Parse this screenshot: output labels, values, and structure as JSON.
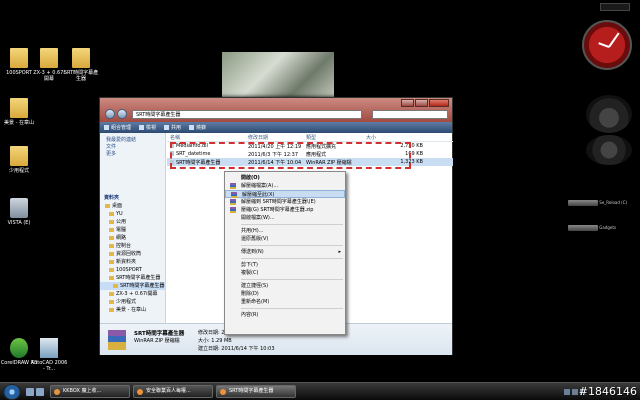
{
  "desktop": {
    "icons": [
      {
        "label": "100SPORT",
        "kind": "folder"
      },
      {
        "label": "ZX-3 + 0.67i 開幕",
        "kind": "folder"
      },
      {
        "label": "SRT時間字幕產生器",
        "kind": "folder"
      },
      {
        "label": "美景 - 在章山",
        "kind": "folder"
      },
      {
        "label": "少用程式",
        "kind": "folder"
      },
      {
        "label": "VISTA (E)",
        "kind": "drive"
      },
      {
        "label": "CorelDRAW X3",
        "kind": "app"
      },
      {
        "label": "AutoCAD 2006 - Tr...",
        "kind": "app"
      }
    ]
  },
  "gadgets": {
    "drive1": "Se_Reload (C)",
    "drive2": "Gadgets"
  },
  "window": {
    "address": "SRT時間字幕產生器",
    "toolbar": [
      "組合管理",
      "檢視",
      "共用",
      "燒錄"
    ],
    "favorites": [
      "我最愛的連結",
      "文件",
      "更多"
    ],
    "tree_header": "資料夾",
    "tree": [
      {
        "label": "桌面",
        "selected": false
      },
      {
        "label": "YU",
        "selected": false
      },
      {
        "label": "公用",
        "selected": false
      },
      {
        "label": "電腦",
        "selected": false
      },
      {
        "label": "網路",
        "selected": false
      },
      {
        "label": "控制台",
        "selected": false
      },
      {
        "label": "資源回收筒",
        "selected": false
      },
      {
        "label": "新資料夾",
        "selected": false
      },
      {
        "label": "100SPORT",
        "selected": false
      },
      {
        "label": "SRT時間字幕產生器",
        "selected": false
      },
      {
        "label": "SRT時間字幕產生器",
        "selected": true
      },
      {
        "label": "ZX-3 + 0.67i開幕",
        "selected": false
      },
      {
        "label": "少用程式",
        "selected": false
      },
      {
        "label": "美景 - 在章山",
        "selected": false
      }
    ],
    "columns": [
      "名稱",
      "修改日期",
      "類型",
      "大小"
    ],
    "rows": [
      {
        "name": "MediaInfo.dll",
        "date": "2011/4/20 上午 12:19",
        "type": "應用程式擴充",
        "size": "2,720 KB",
        "selected": false
      },
      {
        "name": "SRT_datetime",
        "date": "2011/6/3 下午 12:37",
        "type": "應用程式",
        "size": "169 KB",
        "selected": false
      },
      {
        "name": "SRT時間字幕產生器",
        "date": "2011/6/14 下午 10:04",
        "type": "WinRAR ZIP 壓縮檔",
        "size": "1,323 KB",
        "selected": true
      }
    ],
    "details": {
      "name": "SRT時間字幕產生器",
      "type": "WinRAR ZIP 壓縮檔",
      "modified_label": "修改日期: 2011/6/14 下午 10:04",
      "size_label": "大小: 1.29 MB",
      "created_label": "建立日期: 2011/6/14 下午 10:03"
    }
  },
  "context_menu": {
    "items": [
      {
        "label": "開啟(O)",
        "bold": true,
        "icon": false,
        "arrow": false,
        "sep_after": false,
        "highlight": false
      },
      {
        "label": "解壓縮檔案(A)...",
        "bold": false,
        "icon": true,
        "arrow": false,
        "sep_after": false,
        "highlight": false
      },
      {
        "label": "解壓縮至此(X)",
        "bold": false,
        "icon": true,
        "arrow": false,
        "sep_after": false,
        "highlight": true
      },
      {
        "label": "解壓縮到 SRT時間字幕產生器\\(E)",
        "bold": false,
        "icon": true,
        "arrow": false,
        "sep_after": false,
        "highlight": false
      },
      {
        "label": "壓縮(G) SRT時間字幕產生器.zip",
        "bold": false,
        "icon": true,
        "arrow": false,
        "sep_after": false,
        "highlight": false
      },
      {
        "label": "開啟檔案(W)...",
        "bold": false,
        "icon": false,
        "arrow": false,
        "sep_after": true,
        "highlight": false
      },
      {
        "label": "共用(H)...",
        "bold": false,
        "icon": false,
        "arrow": false,
        "sep_after": false,
        "highlight": false
      },
      {
        "label": "還原舊版(V)",
        "bold": false,
        "icon": false,
        "arrow": false,
        "sep_after": true,
        "highlight": false
      },
      {
        "label": "傳送到(N)",
        "bold": false,
        "icon": false,
        "arrow": true,
        "sep_after": true,
        "highlight": false
      },
      {
        "label": "剪下(T)",
        "bold": false,
        "icon": false,
        "arrow": false,
        "sep_after": false,
        "highlight": false
      },
      {
        "label": "複製(C)",
        "bold": false,
        "icon": false,
        "arrow": false,
        "sep_after": true,
        "highlight": false
      },
      {
        "label": "建立捷徑(S)",
        "bold": false,
        "icon": false,
        "arrow": false,
        "sep_after": false,
        "highlight": false
      },
      {
        "label": "刪除(D)",
        "bold": false,
        "icon": false,
        "arrow": false,
        "sep_after": false,
        "highlight": false
      },
      {
        "label": "重新命名(M)",
        "bold": false,
        "icon": false,
        "arrow": false,
        "sep_after": true,
        "highlight": false
      },
      {
        "label": "內容(R)",
        "bold": false,
        "icon": false,
        "arrow": false,
        "sep_after": false,
        "highlight": false
      }
    ]
  },
  "taskbar": {
    "tasks": [
      {
        "label": "KKBOX 魔上收...",
        "active": false
      },
      {
        "label": "安全聯業百人每權...",
        "active": false
      },
      {
        "label": "SRT時間字幕產生器",
        "active": true
      }
    ]
  },
  "watermark": "#1846146"
}
